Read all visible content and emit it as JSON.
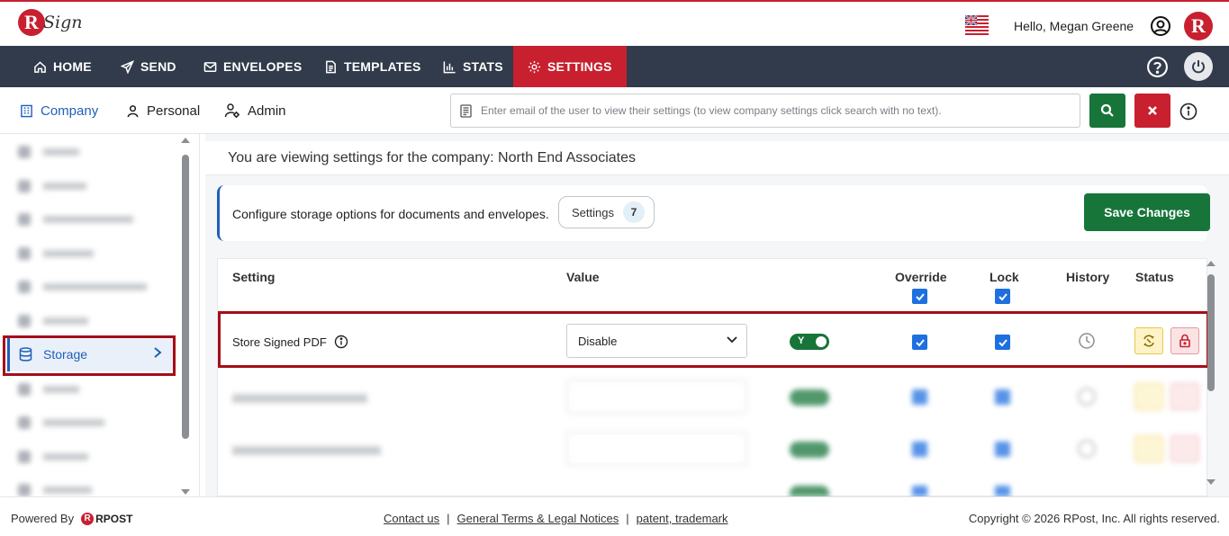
{
  "header": {
    "logo_text": "Sign",
    "greeting": "Hello, Megan Greene",
    "brand_badge": "R"
  },
  "nav": {
    "items": [
      {
        "label": "HOME",
        "icon": "home-icon"
      },
      {
        "label": "SEND",
        "icon": "send-icon"
      },
      {
        "label": "ENVELOPES",
        "icon": "envelope-icon"
      },
      {
        "label": "TEMPLATES",
        "icon": "template-icon"
      },
      {
        "label": "STATS",
        "icon": "stats-icon"
      },
      {
        "label": "SETTINGS",
        "icon": "gear-icon",
        "active": true
      }
    ]
  },
  "subtabs": {
    "company": "Company",
    "personal": "Personal",
    "admin": "Admin"
  },
  "search": {
    "placeholder": "Enter email of the user to view their settings (to view company settings click search with no text)."
  },
  "sidebar": {
    "active_item": "Storage"
  },
  "main": {
    "heading": "You are viewing settings for the company: North End Associates",
    "description": "Configure storage options for documents and envelopes.",
    "settings_label": "Settings",
    "settings_count": "7",
    "save_label": "Save Changes"
  },
  "table": {
    "headers": {
      "setting": "Setting",
      "value": "Value",
      "override": "Override",
      "lock": "Lock",
      "history": "History",
      "status": "Status"
    },
    "row": {
      "label": "Store Signed PDF",
      "value": "Disable",
      "toggle": "Y",
      "override": true,
      "lock": true
    }
  },
  "footer": {
    "powered_by": "Powered By",
    "rpost": "RPOST",
    "contact": "Contact us",
    "terms": "General Terms & Legal Notices",
    "patent": "patent, trademark",
    "separator": "|",
    "copyright": "Copyright © 2026 RPost, Inc. All rights reserved."
  },
  "colors": {
    "accent_red": "#c8202f",
    "nav_bg": "#313b4b",
    "primary_green": "#17753a",
    "link_blue": "#1f5fb8"
  }
}
